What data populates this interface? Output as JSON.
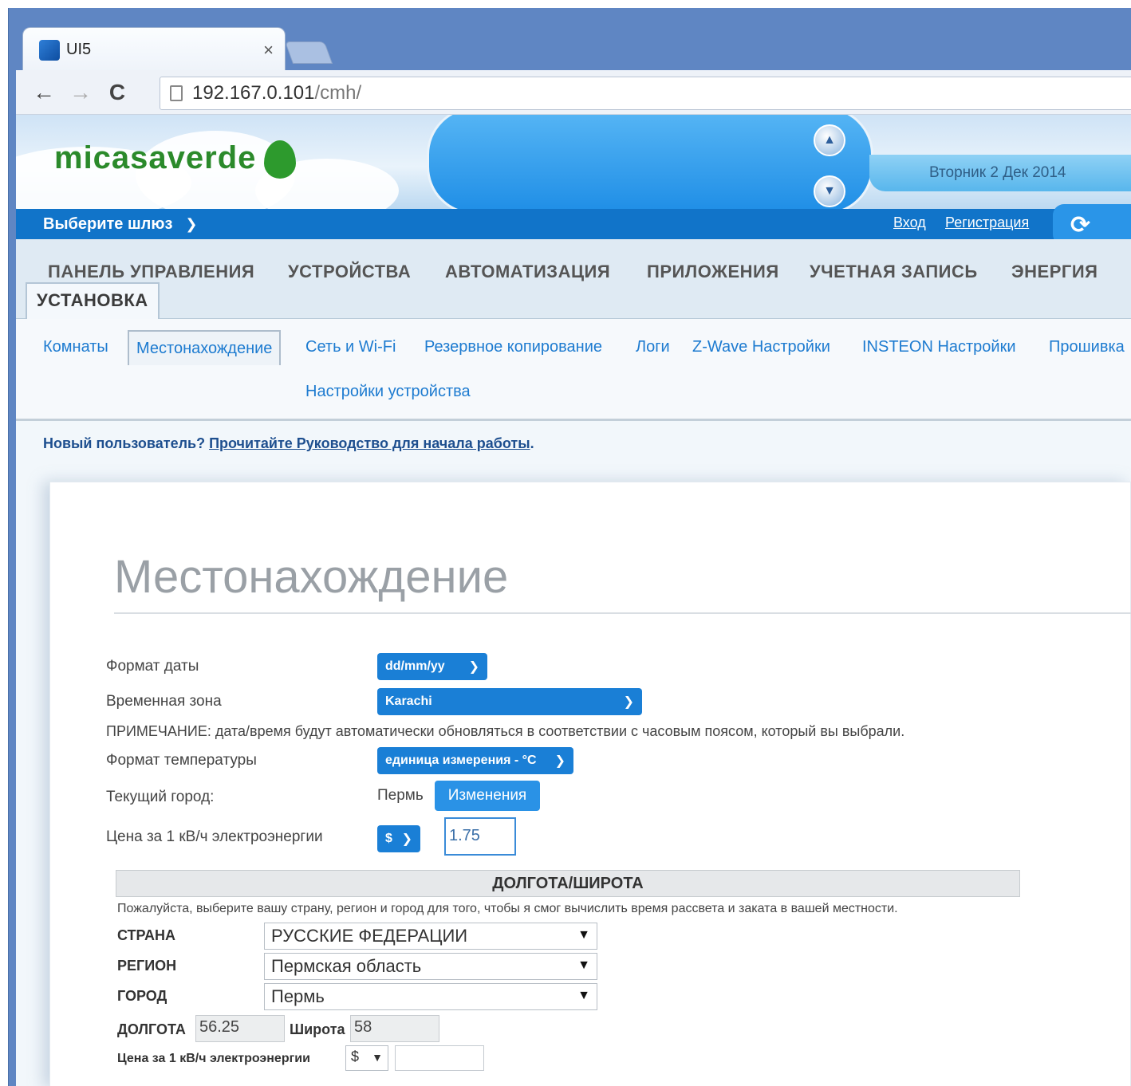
{
  "browser": {
    "tab_title": "UI5",
    "tab_close": "×",
    "url_host": "192.167.0.101",
    "url_path": "/cmh/"
  },
  "header": {
    "logo": "micasaverde",
    "date": "Вторник 2 Дек 2014"
  },
  "gateway_bar": {
    "select_label": "Выберите шлюз",
    "login": "Вход",
    "register": "Регистрация"
  },
  "main_nav": {
    "items": [
      "ПАНЕЛЬ УПРАВЛЕНИЯ",
      "УСТРОЙСТВА",
      "АВТОМАТИЗАЦИЯ",
      "ПРИЛОЖЕНИЯ",
      "УЧЕТНАЯ ЗАПИСЬ",
      "ЭНЕРГИЯ"
    ],
    "active": "УСТАНОВКА"
  },
  "sub_nav": {
    "items": [
      "Комнаты",
      "Местонахождение",
      "Сеть и Wi-Fi",
      "Резервное копирование",
      "Логи",
      "Z-Wave Настройки",
      "INSTEON Настройки",
      "Прошивка",
      "Настройки устройства"
    ]
  },
  "welcome": {
    "prefix": "Новый пользователь? ",
    "link": "Прочитайте Руководство для начала работы",
    "suffix": "."
  },
  "location": {
    "title": "Местонахождение",
    "date_format_label": "Формат даты",
    "date_format_value": "dd/mm/yy",
    "timezone_label": "Временная зона",
    "timezone_value": "Karachi",
    "note": "ПРИМЕЧАНИЕ: дата/время будут автоматически обновляться в соответствии с часовым поясом, который вы выбрали.",
    "temp_format_label": "Формат температуры",
    "temp_format_value": "единица измерения - °C",
    "city_label": "Текущий город:",
    "city_value": "Пермь",
    "change_button": "Изменения",
    "price_label": "Цена за 1 кВ/ч электроэнергии",
    "currency_value": "$",
    "price_value": "1.75"
  },
  "geo": {
    "header": "ДОЛГОТА/ШИРОТА",
    "description": "Пожалуйста, выберите вашу страну, регион и город для того, чтобы я смог вычислить время рассвета и заката в вашей местности.",
    "country_label": "СТРАНА",
    "country_value": "РУССКИЕ ФЕДЕРАЦИИ",
    "region_label": "РЕГИОН",
    "region_value": "Пермская область",
    "city_label": "ГОРОД",
    "city_value": "Пермь",
    "longitude_label": "ДОЛГОТА",
    "longitude_value": "56.25",
    "latitude_label": "Широта",
    "latitude_value": "58",
    "price_label": "Цена за 1 кВ/ч электроэнергии",
    "currency_value": "$"
  },
  "icons": {
    "back": "←",
    "forward": "→",
    "reload": "C",
    "chevron": "⌄",
    "arrow_down": "▼",
    "up": "▲",
    "down": "▼"
  },
  "colors": {
    "brand_blue": "#1174c9",
    "accent_blue": "#1a7fd6",
    "logo_green": "#2b8a2b"
  }
}
